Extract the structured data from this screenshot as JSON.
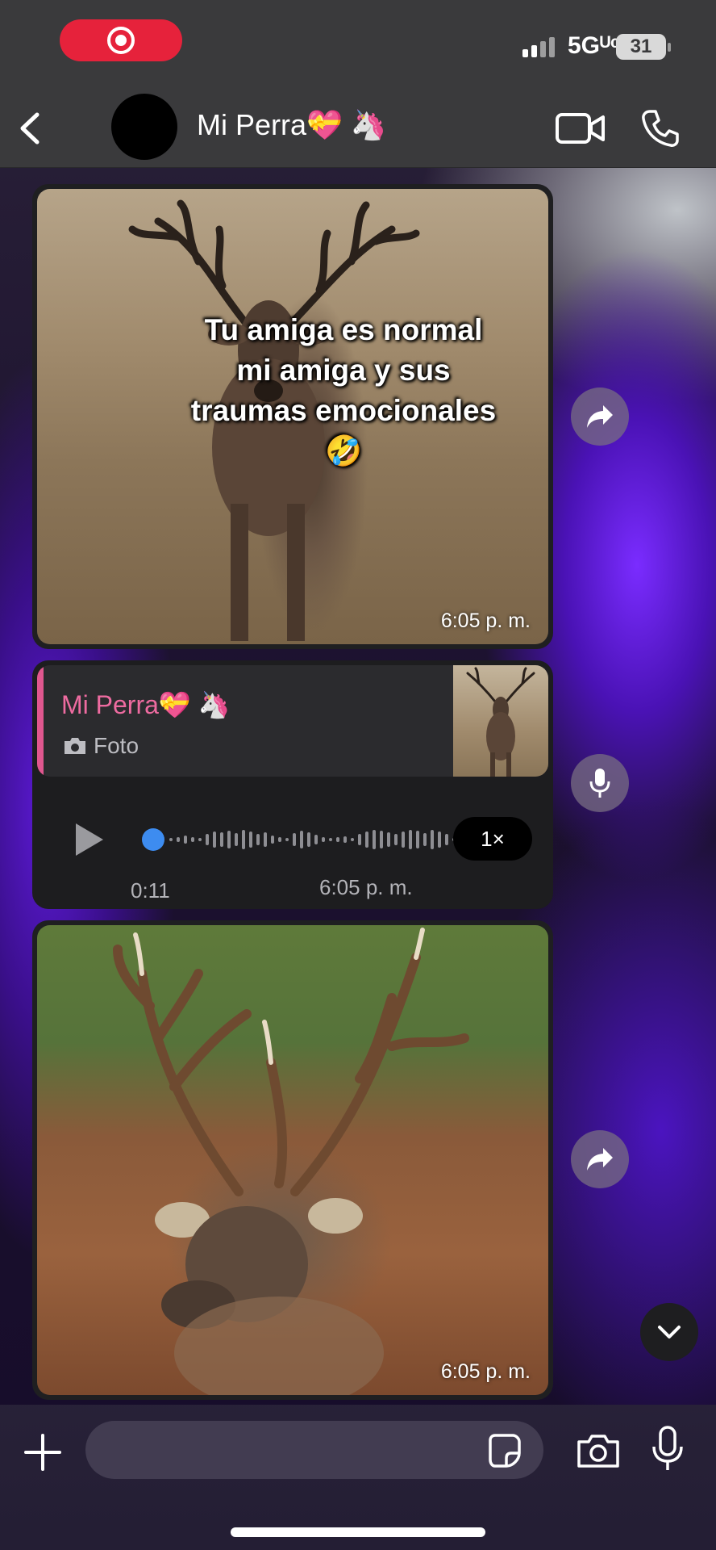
{
  "status_bar": {
    "network": "5Gᵁᶜ",
    "battery": "31"
  },
  "header": {
    "contact_name": "Mi Perra💝 🦄"
  },
  "messages": [
    {
      "type": "image",
      "caption": "Tu amiga es normal mi amiga y sus traumas emocionales 🤣",
      "time": "6:05 p. m."
    },
    {
      "type": "voice",
      "reply_to": {
        "name": "Mi Perra💝 🦄",
        "kind": "Foto"
      },
      "duration": "0:11",
      "time": "6:05 p. m.",
      "speed": "1×",
      "progress": 0.0
    },
    {
      "type": "image",
      "time": "6:05 p. m."
    }
  ],
  "composer": {
    "placeholder": ""
  },
  "colors": {
    "recording": "#e6223b",
    "reply_accent": "#ee6ba0",
    "wave_accent": "#3d8cf0"
  }
}
